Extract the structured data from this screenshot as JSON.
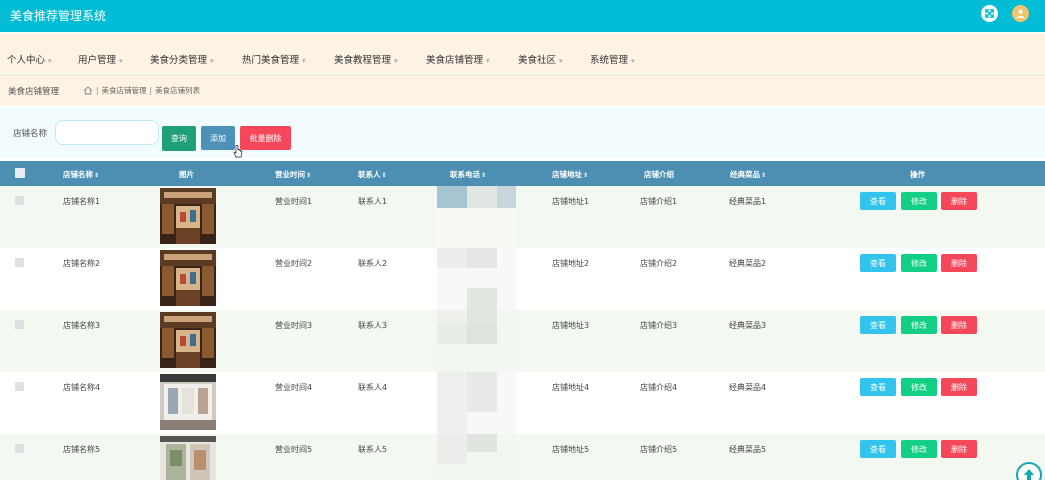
{
  "app": {
    "title": "美食推荐管理系统",
    "icons": {
      "fullscreen": "fullscreen-toggle-icon",
      "avatar": "user-avatar-icon"
    },
    "colors": {
      "topbar": "#00bcd4",
      "nav_bg": "#fdf3e5",
      "table_head": "#4d8fb3",
      "view": "#33c4ee",
      "edit": "#13cf85",
      "delete": "#f5475a"
    }
  },
  "nav": {
    "items": [
      {
        "label": "个人中心"
      },
      {
        "label": "用户管理"
      },
      {
        "label": "美食分类管理"
      },
      {
        "label": "热门美食管理"
      },
      {
        "label": "美食教程管理"
      },
      {
        "label": "美食店铺管理"
      },
      {
        "label": "美食社区"
      },
      {
        "label": "系统管理"
      }
    ]
  },
  "breadcrumb": {
    "title": "美食店铺管理",
    "items": [
      "美食店铺管理",
      "美食店铺列表"
    ]
  },
  "search": {
    "label": "店铺名称",
    "value": "",
    "placeholder": "",
    "query_label": "查询",
    "add_label": "添加",
    "batch_delete_label": "批量删除"
  },
  "table": {
    "headers": {
      "name": "店铺名称",
      "image": "图片",
      "hours": "营业时间",
      "contact": "联系人",
      "phone": "联系电话",
      "address": "店铺地址",
      "intro": "店铺介绍",
      "dish": "经典菜品",
      "actions": "操作"
    },
    "actions": {
      "view": "查看",
      "edit": "修改",
      "delete": "删除"
    },
    "rows": [
      {
        "name": "店铺名称1",
        "hours": "营业时间1",
        "contact": "联系人1",
        "address": "店铺地址1",
        "intro": "店铺介绍1",
        "dish": "经典菜品1"
      },
      {
        "name": "店铺名称2",
        "hours": "营业时间2",
        "contact": "联系人2",
        "address": "店铺地址2",
        "intro": "店铺介绍2",
        "dish": "经典菜品2"
      },
      {
        "name": "店铺名称3",
        "hours": "营业时间3",
        "contact": "联系人3",
        "address": "店铺地址3",
        "intro": "店铺介绍3",
        "dish": "经典菜品3"
      },
      {
        "name": "店铺名称4",
        "hours": "营业时间4",
        "contact": "联系人4",
        "address": "店铺地址4",
        "intro": "店铺介绍4",
        "dish": "经典菜品4"
      },
      {
        "name": "店铺名称5",
        "hours": "营业时间5",
        "contact": "联系人5",
        "address": "店铺地址5",
        "intro": "店铺介绍5",
        "dish": "经典菜品5"
      }
    ]
  }
}
